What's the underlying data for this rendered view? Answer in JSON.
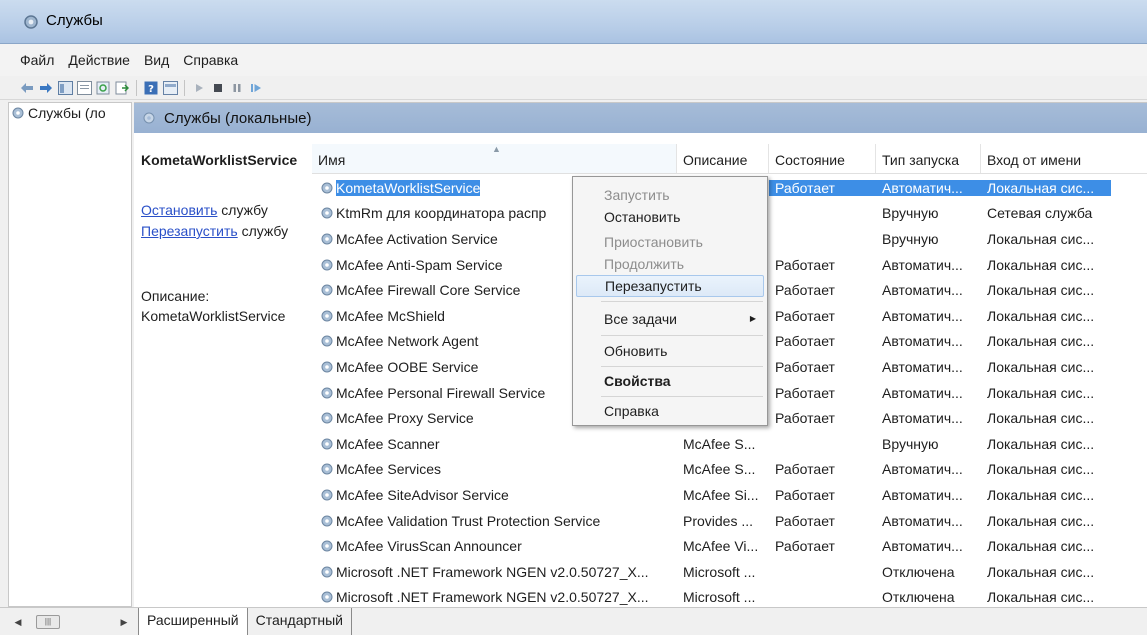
{
  "window": {
    "title": "Службы"
  },
  "menu": [
    {
      "label": "Файл"
    },
    {
      "label": "Действие"
    },
    {
      "label": "Вид"
    },
    {
      "label": "Справка"
    }
  ],
  "tree": {
    "root_label": "Службы (ло"
  },
  "main": {
    "header_title": "Службы (локальные)"
  },
  "extended": {
    "service_name": "KometaWorklistService",
    "stop_link": "Остановить",
    "stop_suffix": " службу",
    "restart_link": "Перезапустить",
    "restart_suffix": " службу",
    "description_label": "Описание:",
    "description_value": "KometaWorklistService"
  },
  "table": {
    "columns": [
      "Имя",
      "Описание",
      "Состояние",
      "Тип запуска",
      "Вход от имени"
    ],
    "rows": [
      {
        "name": "KometaWorklistService",
        "desc": "",
        "state": "Работает",
        "start": "Автоматич...",
        "logon": "Локальная сис...",
        "selected": true
      },
      {
        "name": "KtmRm для координатора распр",
        "desc": "",
        "state": "",
        "start": "Вручную",
        "logon": "Сетевая служба"
      },
      {
        "name": "McAfee Activation Service",
        "desc": "",
        "state": "",
        "start": "Вручную",
        "logon": "Локальная сис..."
      },
      {
        "name": "McAfee Anti-Spam Service",
        "desc": "",
        "state": "Работает",
        "start": "Автоматич...",
        "logon": "Локальная сис..."
      },
      {
        "name": "McAfee Firewall Core Service",
        "desc": "",
        "state": "Работает",
        "start": "Автоматич...",
        "logon": "Локальная сис..."
      },
      {
        "name": "McAfee McShield",
        "desc": "",
        "state": "Работает",
        "start": "Автоматич...",
        "logon": "Локальная сис..."
      },
      {
        "name": "McAfee Network Agent",
        "desc": "",
        "state": "Работает",
        "start": "Автоматич...",
        "logon": "Локальная сис..."
      },
      {
        "name": "McAfee OOBE Service",
        "desc": "",
        "state": "Работает",
        "start": "Автоматич...",
        "logon": "Локальная сис..."
      },
      {
        "name": "McAfee Personal Firewall Service",
        "desc": "",
        "state": "Работает",
        "start": "Автоматич...",
        "logon": "Локальная сис..."
      },
      {
        "name": "McAfee Proxy Service",
        "desc": "",
        "state": "Работает",
        "start": "Автоматич...",
        "logon": "Локальная сис..."
      },
      {
        "name": "McAfee Scanner",
        "desc": "McAfee S...",
        "state": "",
        "start": "Вручную",
        "logon": "Локальная сис..."
      },
      {
        "name": "McAfee Services",
        "desc": "McAfee S...",
        "state": "Работает",
        "start": "Автоматич...",
        "logon": "Локальная сис..."
      },
      {
        "name": "McAfee SiteAdvisor Service",
        "desc": "McAfee Si...",
        "state": "Работает",
        "start": "Автоматич...",
        "logon": "Локальная сис..."
      },
      {
        "name": "McAfee Validation Trust Protection Service",
        "desc": "Provides ...",
        "state": "Работает",
        "start": "Автоматич...",
        "logon": "Локальная сис..."
      },
      {
        "name": "McAfee VirusScan Announcer",
        "desc": "McAfee Vi...",
        "state": "Работает",
        "start": "Автоматич...",
        "logon": "Локальная сис..."
      },
      {
        "name": "Microsoft .NET Framework NGEN v2.0.50727_X...",
        "desc": "Microsoft ...",
        "state": "",
        "start": "Отключена",
        "logon": "Локальная сис..."
      },
      {
        "name": "Microsoft .NET Framework NGEN v2.0.50727_X...",
        "desc": "Microsoft ...",
        "state": "",
        "start": "Отключена",
        "logon": "Локальная сис..."
      }
    ]
  },
  "context_menu": {
    "start": "Запустить",
    "stop": "Остановить",
    "pause": "Приостановить",
    "resume": "Продолжить",
    "restart": "Перезапустить",
    "all_tasks": "Все задачи",
    "refresh": "Обновить",
    "properties": "Свойства",
    "help": "Справка"
  },
  "tabs": {
    "extended": "Расширенный",
    "standard": "Стандартный"
  },
  "colors": {
    "selection": "#3d8ee6",
    "header_bar": "#a6bcd8",
    "link": "#2a50c8"
  }
}
